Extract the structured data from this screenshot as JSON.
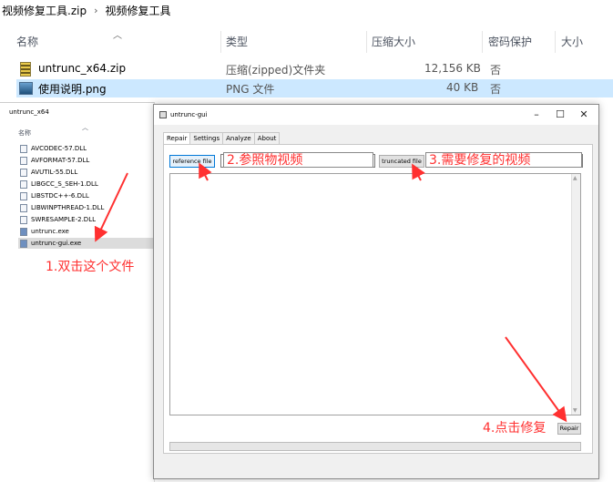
{
  "explorer": {
    "breadcrumb": [
      "视频修复工具.zip",
      "视频修复工具"
    ],
    "columns": [
      "名称",
      "类型",
      "压缩大小",
      "密码保护",
      "大小"
    ],
    "files": [
      {
        "name": "untrunc_x64.zip",
        "type": "压缩(zipped)文件夹",
        "size": "12,156 KB",
        "protected": "否",
        "icon": "zip-icon"
      },
      {
        "name": "使用说明.png",
        "type": "PNG 文件",
        "size": "40 KB",
        "protected": "否",
        "icon": "png-icon"
      }
    ]
  },
  "pane2": {
    "title": "untrunc_x64",
    "column": "名称",
    "items": [
      "AVCODEC-57.DLL",
      "AVFORMAT-57.DLL",
      "AVUTIL-55.DLL",
      "LIBGCC_S_SEH-1.DLL",
      "LIBSTDC++-6.DLL",
      "LIBWINPTHREAD-1.DLL",
      "SWRESAMPLE-2.DLL",
      "untrunc.exe",
      "untrunc-gui.exe"
    ]
  },
  "app": {
    "title": "untrunc-gui",
    "controls": {
      "minimize": "–",
      "maximize": "☐",
      "close": "✕"
    },
    "tabs": [
      "Repair",
      "Settings",
      "Analyze",
      "About"
    ],
    "reference_button": "reference file",
    "truncated_button": "truncated file",
    "repair_button": "Repair"
  },
  "annotations": {
    "step1": "1.双击这个文件",
    "step2": "2.参照物视频",
    "step3": "3.需要修复的视频",
    "step4": "4.点击修复",
    "color": "#ff3030"
  }
}
